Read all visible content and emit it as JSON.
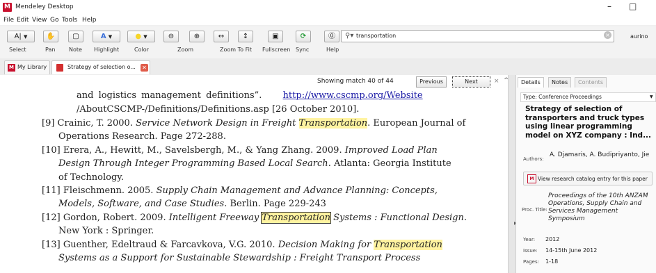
{
  "window": {
    "title": "Mendeley Desktop",
    "logo_glyph": "M",
    "min_glyph": "–",
    "max_glyph": "□"
  },
  "menu": [
    "File",
    "Edit",
    "View",
    "Go",
    "Tools",
    "Help"
  ],
  "toolbar": {
    "buttons": [
      {
        "label": "Select",
        "icon": "text-cursor-icon",
        "glyph": "A|"
      },
      {
        "label": "Pan",
        "icon": "hand-icon",
        "glyph": "✋"
      },
      {
        "label": "Note",
        "icon": "note-icon",
        "glyph": "▢"
      },
      {
        "label": "Highlight",
        "icon": "highlighter-icon",
        "glyph": "A"
      },
      {
        "label": "Color",
        "icon": "color-circle-icon",
        "glyph": "●"
      },
      {
        "label": "Zoom",
        "icon": "zoom-icon",
        "glyph": "⊖ ⊕"
      },
      {
        "label": "Zoom To Fit",
        "icon": "fit-icon",
        "glyph": "↔  ↕"
      },
      {
        "label": "Fullscreen",
        "icon": "fullscreen-icon",
        "glyph": "⛶"
      },
      {
        "label": "Sync",
        "icon": "sync-icon",
        "glyph": "⟳"
      },
      {
        "label": "Help",
        "icon": "help-icon",
        "glyph": "?"
      }
    ],
    "search_value": "transportation",
    "user": "aurino",
    "accent": "#c8102e"
  },
  "tabs": {
    "library": "My Library",
    "document": "Strategy of selection o...",
    "close_glyph": "✕"
  },
  "findbar": {
    "status": "Showing match 40 of 44",
    "previous": "Previous",
    "next": "Next",
    "close": "×",
    "up": "^"
  },
  "document": {
    "line1a": "and     logistics     management     definitions”.",
    "line1_link": "http://www.cscmp.org/Website",
    "line2": "/AboutCSCMP-/Definitions/Definitions.asp [26 October 2010].",
    "r9a": "[9] Crainic, T. 2000. ",
    "r9b": "Service Network Design in Freight ",
    "r9hl": "Transportation",
    "r9c": ". European Journal of",
    "r9d": "Operations Research. Page 272-288.",
    "r10a": "[10] Erera, A., Hewitt, M., Savelsbergh, M., & Yang Zhang. 2009. ",
    "r10b": "Improved Load Plan",
    "r10c": "Design Through Integer Programming Based Local Search",
    "r10d": ". Atlanta: Georgia Institute",
    "r10e": "of Technology.",
    "r11a": "[11] Fleischmenn. 2005. ",
    "r11b": "Supply Chain Management and Advance Planning: Concepts,",
    "r11c": "Models, Software, and Case Studies",
    "r11d": ". Berlin. Page 229-243",
    "r12a": "[12] Gordon, Robert. 2009. ",
    "r12b": "Intelligent Freeway ",
    "r12hl": "Transportation",
    "r12c": " Systems : Functional Design",
    "r12d": ".",
    "r12e": "New York : Springer.",
    "r13a": "[13] Guenther, Edeltraud & Farcavkova, V.G. 2010. ",
    "r13b": "Decision Making for ",
    "r13hl": "Transportation",
    "r13c": "Systems as a Support for Sustainable Stewardship : Freight Transport Process",
    "highlight_color": "#fff3a0"
  },
  "details": {
    "tabs": [
      "Details",
      "Notes",
      "Contents"
    ],
    "type_label": "Type:",
    "type_value": "Conference Proceedings",
    "title": "Strategy of selection of transporters and truck types using linear programming model on XYZ company : Ind...",
    "authors_label": "Authors:",
    "authors_value": "A. Djamaris, A. Budipriyanto, Jie",
    "catalog_button": "View research catalog entry for this paper",
    "proc_label": "Proc. Title:",
    "proc_value": "Proceedings of the 10th ANZAM Operations, Supply Chain and Services Management Symposium",
    "year_label": "Year:",
    "year_value": "2012",
    "issue_label": "Issue:",
    "issue_value": "14-15th June 2012",
    "pages_label": "Pages:",
    "pages_value": "1-18"
  }
}
